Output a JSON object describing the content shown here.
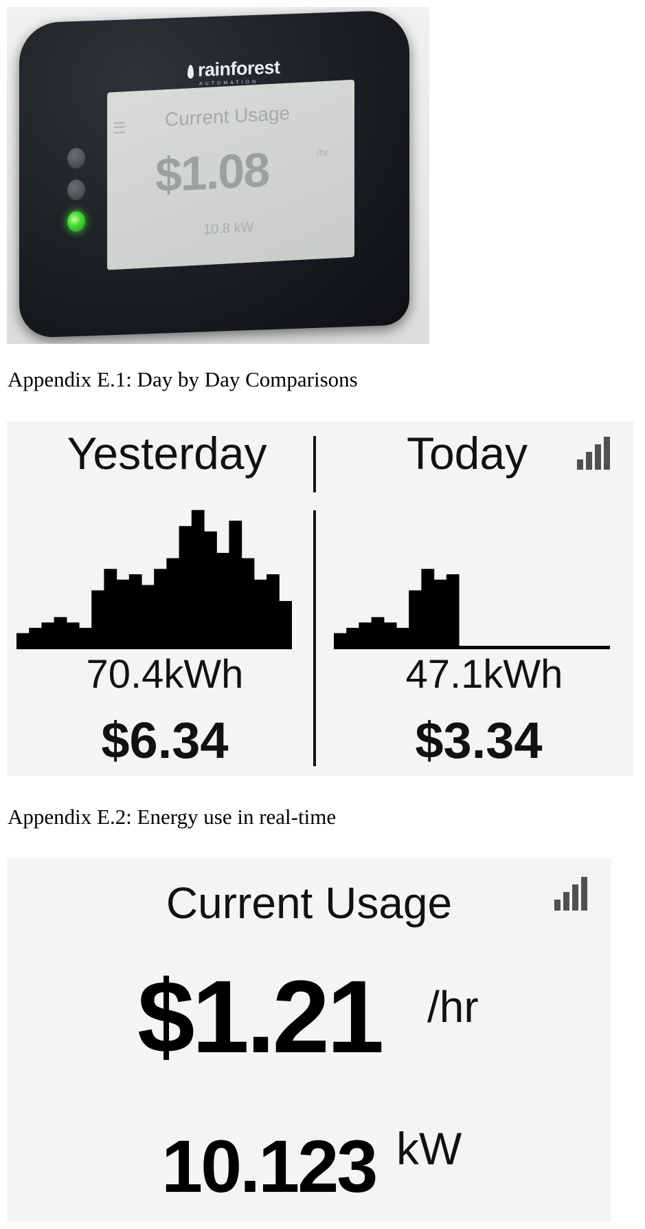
{
  "photo": {
    "brand": "rainforest",
    "brand_sub": "AUTOMATION",
    "screen_title": "Current Usage",
    "screen_value": "$1.08",
    "screen_unit": "/hr",
    "screen_kw": "10.8 kW"
  },
  "captions": {
    "day_by_day": "Appendix E.1: Day by Day Comparisons",
    "real_time": "Appendix E.2: Energy use in real-time"
  },
  "day_compare": {
    "yesterday": {
      "label": "Yesterday",
      "kwh": "70.4kWh",
      "cost": "$6.34"
    },
    "today": {
      "label": "Today",
      "kwh": "47.1kWh",
      "cost": "$3.34"
    },
    "signal_icon": "signal-bars-icon"
  },
  "chart_data": [
    {
      "type": "bar",
      "name": "Yesterday",
      "values": [
        3,
        4,
        5,
        6,
        5,
        4,
        11,
        15,
        13,
        14,
        12,
        15,
        17,
        23,
        26,
        22,
        18,
        24,
        17,
        13,
        14,
        9
      ],
      "ylim": [
        0,
        28
      ]
    },
    {
      "type": "bar",
      "name": "Today",
      "values": [
        3,
        4,
        5,
        6,
        5,
        4,
        11,
        15,
        13,
        14
      ],
      "ylim": [
        0,
        28
      ]
    }
  ],
  "current_usage": {
    "title": "Current Usage",
    "cost": "$1.21",
    "cost_unit": "/hr",
    "power": "10.123",
    "power_unit": "kW",
    "signal_icon": "signal-bars-icon"
  },
  "colors": {
    "panel_bg": "#f4f4f4",
    "ink": "#000000",
    "signal": "#505050",
    "led_green": "#46d935"
  }
}
